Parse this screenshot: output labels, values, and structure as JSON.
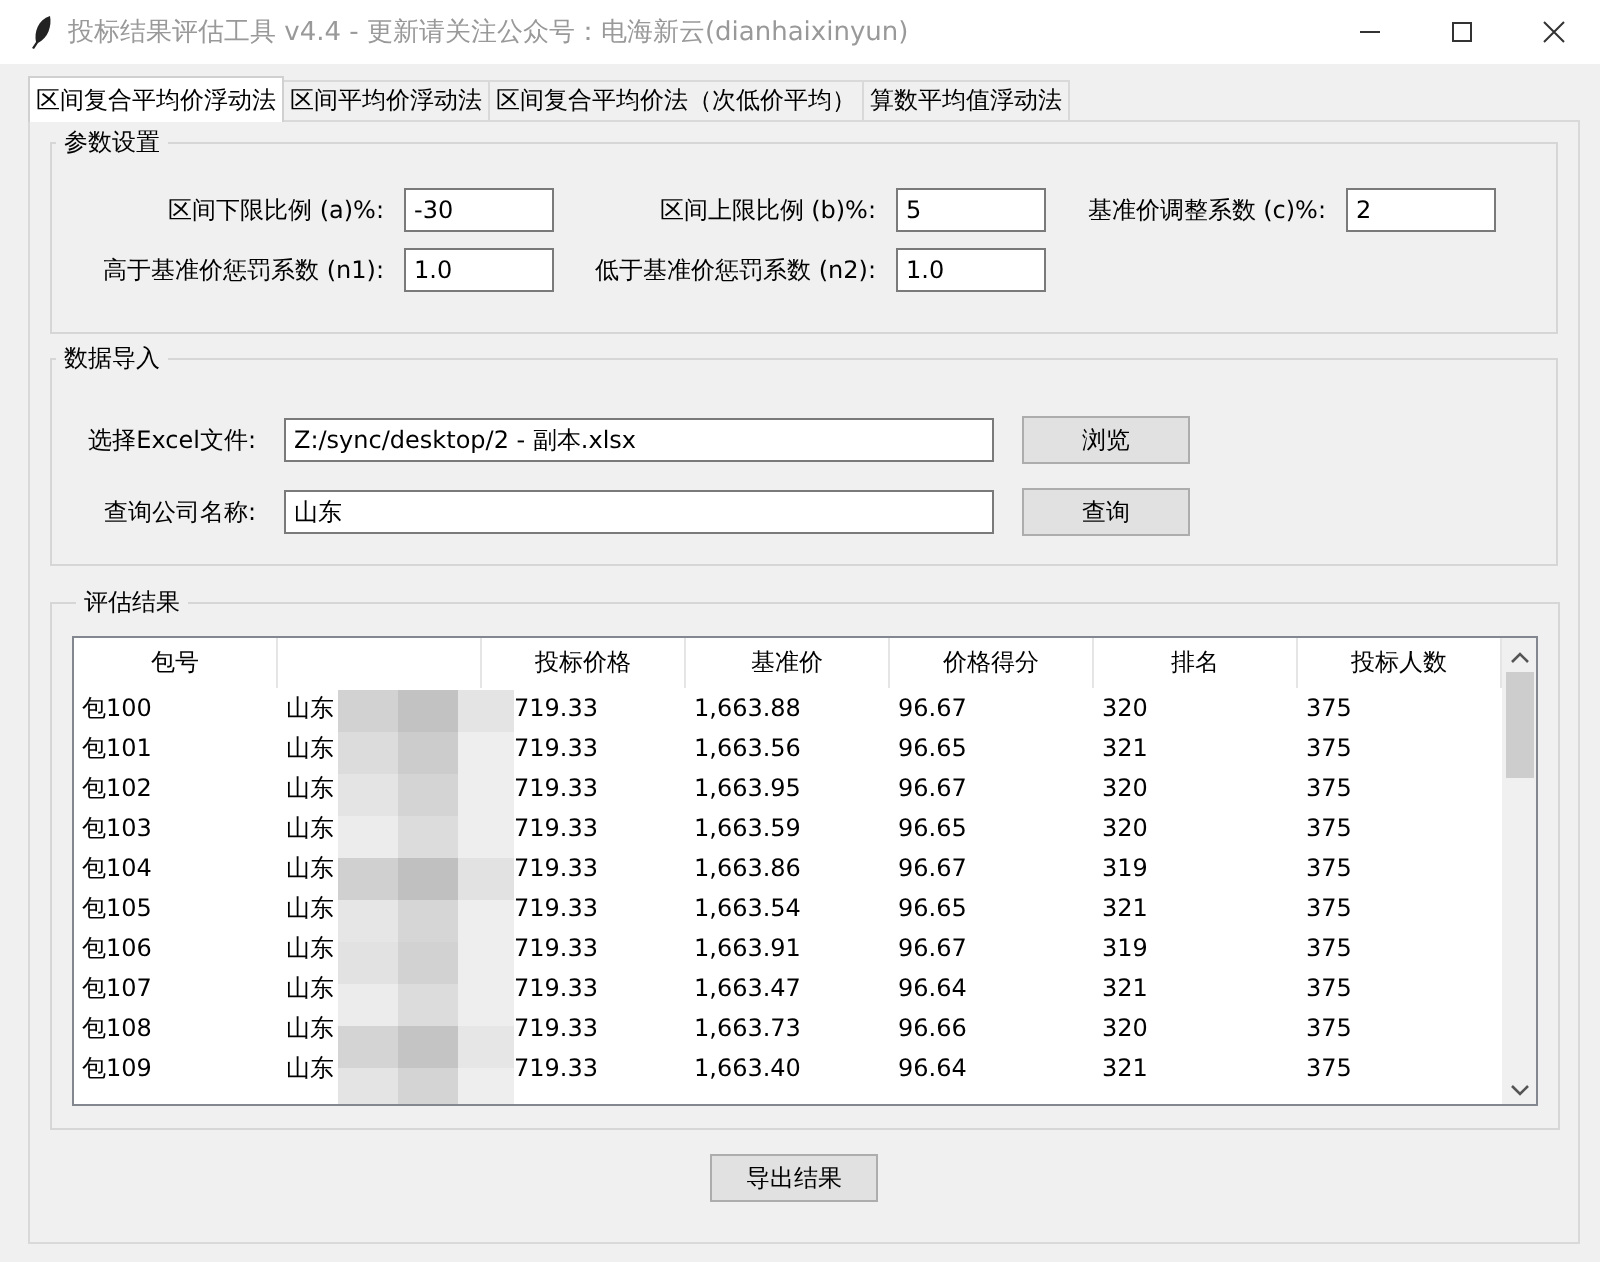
{
  "window": {
    "title": "投标结果评估工具 v4.4 - 更新请关注公众号：电海新云(dianhaixinyun)"
  },
  "tabs": [
    {
      "label": "区间复合平均价浮动法",
      "selected": true
    },
    {
      "label": "区间平均价浮动法",
      "selected": false
    },
    {
      "label": "区间复合平均价法（次低价平均）",
      "selected": false
    },
    {
      "label": "算数平均值浮动法",
      "selected": false
    }
  ],
  "params": {
    "title": "参数设置",
    "fields": [
      {
        "label": "区间下限比例 (a)%:",
        "value": "-30"
      },
      {
        "label": "区间上限比例 (b)%:",
        "value": "5"
      },
      {
        "label": "基准价调整系数 (c)%:",
        "value": "2"
      },
      {
        "label": "高于基准价惩罚系数 (n1):",
        "value": "1.0"
      },
      {
        "label": "低于基准价惩罚系数 (n2):",
        "value": "1.0"
      }
    ]
  },
  "import": {
    "title": "数据导入",
    "fields": [
      {
        "label": "选择Excel文件:",
        "value": "Z:/sync/desktop/2 - 副本.xlsx",
        "button": "浏览"
      },
      {
        "label": "查询公司名称:",
        "value": "山东",
        "button": "查询"
      }
    ]
  },
  "results": {
    "title": "评估结果",
    "columns": [
      {
        "label": "包号",
        "covered": false
      },
      {
        "covered": true
      },
      {
        "label": "投标价格",
        "covered": false
      },
      {
        "label": "基准价",
        "covered": false
      },
      {
        "label": "价格得分",
        "covered": false
      },
      {
        "label": "排名",
        "covered": false
      },
      {
        "label": "投标人数",
        "covered": false
      }
    ],
    "rows": [
      [
        "包100",
        "山东",
        "719.33",
        "1,663.88",
        "96.67",
        "320",
        "375"
      ],
      [
        "包101",
        "山东",
        "719.33",
        "1,663.56",
        "96.65",
        "321",
        "375"
      ],
      [
        "包102",
        "山东",
        "719.33",
        "1,663.95",
        "96.67",
        "320",
        "375"
      ],
      [
        "包103",
        "山东",
        "719.33",
        "1,663.59",
        "96.65",
        "320",
        "375"
      ],
      [
        "包104",
        "山东",
        "719.33",
        "1,663.86",
        "96.67",
        "319",
        "375"
      ],
      [
        "包105",
        "山东",
        "719.33",
        "1,663.54",
        "96.65",
        "321",
        "375"
      ],
      [
        "包106",
        "山东",
        "719.33",
        "1,663.91",
        "96.67",
        "319",
        "375"
      ],
      [
        "包107",
        "山东",
        "719.33",
        "1,663.47",
        "96.64",
        "321",
        "375"
      ],
      [
        "包108",
        "山东",
        "719.33",
        "1,663.73",
        "96.66",
        "320",
        "375"
      ],
      [
        "包109",
        "山东",
        "719.33",
        "1,663.40",
        "96.64",
        "321",
        "375"
      ]
    ]
  },
  "export_button": "导出结果"
}
